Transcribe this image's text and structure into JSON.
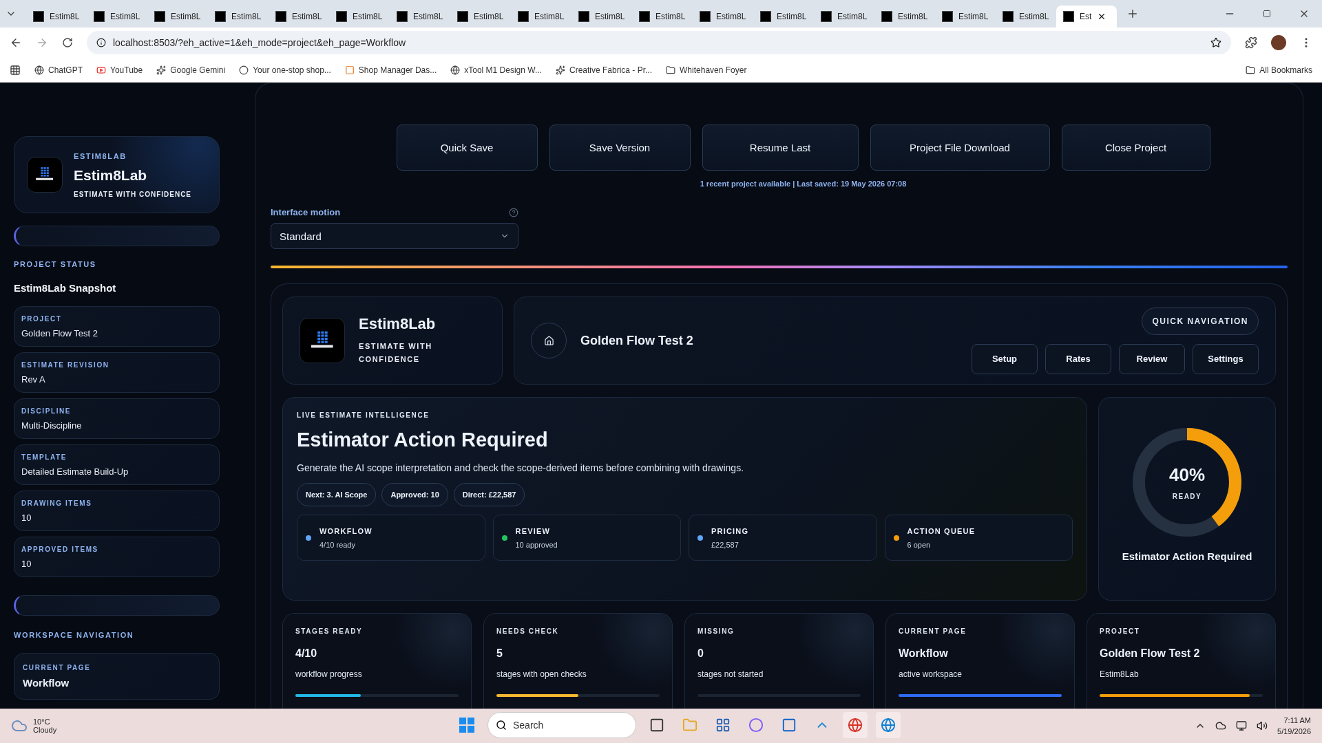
{
  "browser": {
    "tabs": [
      {
        "title": "Estim8L",
        "selected": false
      },
      {
        "title": "Estim8L",
        "selected": false
      },
      {
        "title": "Estim8L",
        "selected": false
      },
      {
        "title": "Estim8L",
        "selected": false
      },
      {
        "title": "Estim8L",
        "selected": false
      },
      {
        "title": "Estim8L",
        "selected": false
      },
      {
        "title": "Estim8L",
        "selected": false
      },
      {
        "title": "Estim8L",
        "selected": false
      },
      {
        "title": "Estim8L",
        "selected": false
      },
      {
        "title": "Estim8L",
        "selected": false
      },
      {
        "title": "Estim8L",
        "selected": false
      },
      {
        "title": "Estim8L",
        "selected": false
      },
      {
        "title": "Estim8L",
        "selected": false
      },
      {
        "title": "Estim8L",
        "selected": false
      },
      {
        "title": "Estim8L",
        "selected": false
      },
      {
        "title": "Estim8L",
        "selected": false
      },
      {
        "title": "Estim8L",
        "selected": false
      },
      {
        "title": "Est",
        "selected": true
      }
    ],
    "url": "localhost:8503/?eh_active=1&eh_mode=project&eh_page=Workflow",
    "bookmarks": [
      "ChatGPT",
      "YouTube",
      "Google Gemini",
      "Your one-stop shop...",
      "Shop Manager Das...",
      "xTool M1 Design W...",
      "Creative Fabrica - Pr...",
      "Whitehaven Foyer"
    ],
    "all_bookmarks": "All Bookmarks"
  },
  "sidebar": {
    "brand": {
      "eyebrow": "ESTIM8LAB",
      "name": "Estim8Lab",
      "tagline": "ESTIMATE WITH CONFIDENCE"
    },
    "status_heading": "PROJECT STATUS",
    "snapshot_title": "Estim8Lab Snapshot",
    "status_items": [
      {
        "label": "PROJECT",
        "value": "Golden Flow Test 2"
      },
      {
        "label": "ESTIMATE REVISION",
        "value": "Rev A"
      },
      {
        "label": "DISCIPLINE",
        "value": "Multi-Discipline"
      },
      {
        "label": "TEMPLATE",
        "value": "Detailed Estimate Build-Up"
      },
      {
        "label": "DRAWING ITEMS",
        "value": "10"
      },
      {
        "label": "APPROVED ITEMS",
        "value": "10"
      }
    ],
    "nav_heading": "WORKSPACE NAVIGATION",
    "current_page": {
      "label": "CURRENT PAGE",
      "value": "Workflow"
    }
  },
  "main": {
    "actions": [
      "Quick Save",
      "Save Version",
      "Resume Last",
      "Project File Download",
      "Close Project"
    ],
    "save_status": "1 recent project available | Last saved: 19 May 2026 07:08",
    "motion": {
      "label": "Interface motion",
      "value": "Standard"
    },
    "brand_card": {
      "name": "Estim8Lab",
      "tagline": "ESTIMATE WITH CONFIDENCE"
    },
    "project": {
      "title": "Golden Flow Test 2",
      "quick_nav": "QUICK NAVIGATION",
      "nav_buttons": [
        "Setup",
        "Rates",
        "Review",
        "Settings"
      ]
    },
    "live": {
      "eyebrow": "LIVE ESTIMATE INTELLIGENCE",
      "title": "Estimator Action Required",
      "description": "Generate the AI scope interpretation and check the scope-derived items before combining with drawings.",
      "chips": [
        "Next: 3. AI Scope",
        "Approved: 10",
        "Direct: £22,587"
      ],
      "signals": [
        {
          "label": "WORKFLOW",
          "value": "4/10 ready",
          "color": "#60a5fa"
        },
        {
          "label": "REVIEW",
          "value": "10 approved",
          "color": "#22c55e"
        },
        {
          "label": "PRICING",
          "value": "£22,587",
          "color": "#60a5fa"
        },
        {
          "label": "ACTION QUEUE",
          "value": "6 open",
          "color": "#f59e0b"
        }
      ]
    },
    "readiness": {
      "percent": "40%",
      "caption": "READY",
      "level": 0.4,
      "title": "Estimator Action Required"
    },
    "stats": [
      {
        "label": "STAGES READY",
        "value": "4/10",
        "subtitle": "workflow progress",
        "level": 0.4,
        "color": "#22b8e6"
      },
      {
        "label": "NEEDS CHECK",
        "value": "5",
        "subtitle": "stages with open checks",
        "level": 0.5,
        "color": "#f5b82e"
      },
      {
        "label": "MISSING",
        "value": "0",
        "subtitle": "stages not started",
        "level": 0
      },
      {
        "label": "CURRENT PAGE",
        "value": "Workflow",
        "subtitle": "active workspace",
        "level": 1,
        "color": "#2f6bf0"
      },
      {
        "label": "PROJECT",
        "value": "Golden Flow Test 2",
        "subtitle": "Estim8Lab",
        "level": 0.92,
        "color": "#f59e0b"
      }
    ]
  },
  "taskbar": {
    "weather": {
      "temp": "10°C",
      "condition": "Cloudy"
    },
    "search": {
      "placeholder": "Search"
    },
    "time": "7:11 AM",
    "date": "5/19/2026"
  }
}
